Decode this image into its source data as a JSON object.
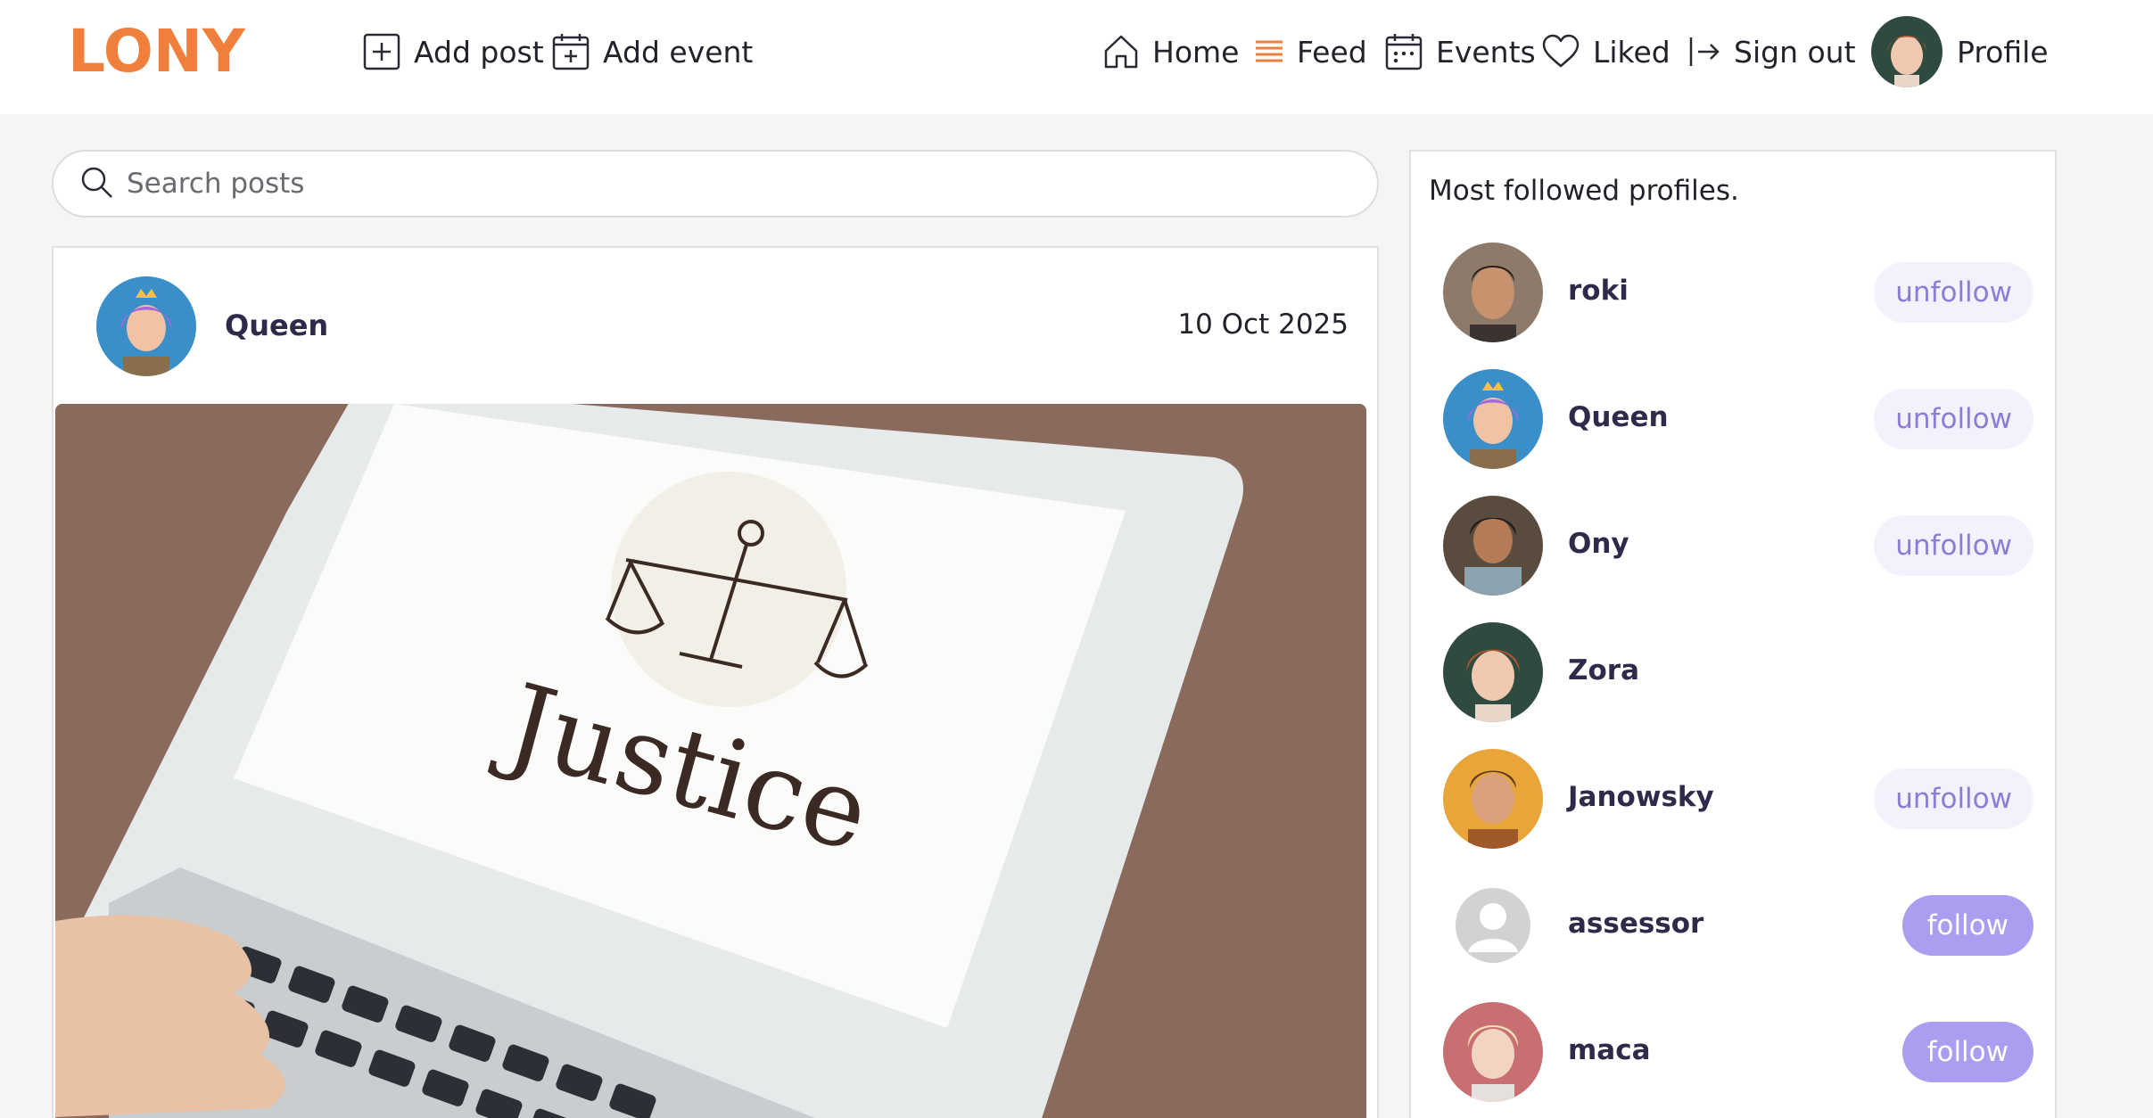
{
  "brand": {
    "logo_text": "LONY",
    "logo_color": "#f07f3c"
  },
  "header": {
    "add_post": "Add post",
    "add_event": "Add event",
    "home": "Home",
    "feed": "Feed",
    "events": "Events",
    "liked": "Liked",
    "sign_out": "Sign out",
    "profile": "Profile"
  },
  "search": {
    "placeholder": "Search posts"
  },
  "post": {
    "author": "Queen",
    "date": "10 Oct 2025",
    "image_text": "Justice"
  },
  "sidebar": {
    "title": "Most followed profiles.",
    "profiles": [
      {
        "name": "roki",
        "action": "unfollow"
      },
      {
        "name": "Queen",
        "action": "unfollow"
      },
      {
        "name": "Ony",
        "action": "unfollow"
      },
      {
        "name": "Zora",
        "action": ""
      },
      {
        "name": "Janowsky",
        "action": "unfollow"
      },
      {
        "name": "assessor",
        "action": "follow"
      },
      {
        "name": "maca",
        "action": "follow"
      }
    ]
  },
  "colors": {
    "accent": "#f07f3c",
    "follow_bg": "#ab9df0",
    "unfollow_bg": "#f3f1fb",
    "unfollow_text": "#8b7dd6"
  }
}
